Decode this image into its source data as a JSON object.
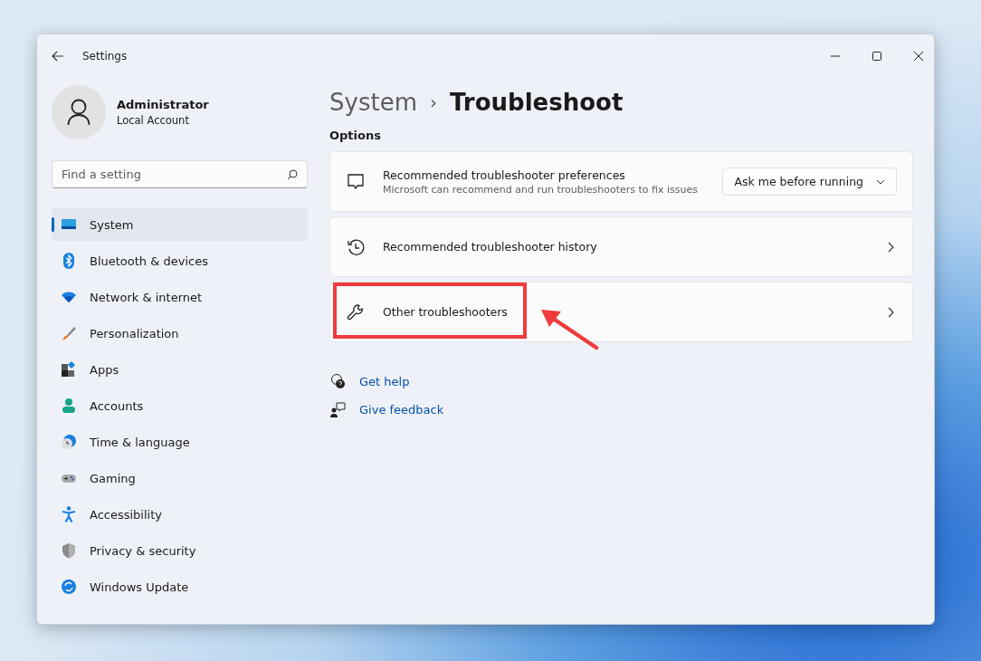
{
  "window": {
    "title": "Settings"
  },
  "account": {
    "name": "Administrator",
    "type": "Local Account"
  },
  "search": {
    "placeholder": "Find a setting"
  },
  "sidebar": {
    "items": [
      {
        "label": "System",
        "selected": true
      },
      {
        "label": "Bluetooth & devices",
        "selected": false
      },
      {
        "label": "Network & internet",
        "selected": false
      },
      {
        "label": "Personalization",
        "selected": false
      },
      {
        "label": "Apps",
        "selected": false
      },
      {
        "label": "Accounts",
        "selected": false
      },
      {
        "label": "Time & language",
        "selected": false
      },
      {
        "label": "Gaming",
        "selected": false
      },
      {
        "label": "Accessibility",
        "selected": false
      },
      {
        "label": "Privacy & security",
        "selected": false
      },
      {
        "label": "Windows Update",
        "selected": false
      }
    ]
  },
  "breadcrumb": {
    "parent": "System",
    "separator": "›",
    "current": "Troubleshoot"
  },
  "section": {
    "title": "Options"
  },
  "options": [
    {
      "kind": "dropdown",
      "title": "Recommended troubleshooter preferences",
      "subtitle": "Microsoft can recommend and run troubleshooters to fix issues",
      "value": "Ask me before running",
      "highlighted": false
    },
    {
      "kind": "link",
      "title": "Recommended troubleshooter history",
      "highlighted": false
    },
    {
      "kind": "link",
      "title": "Other troubleshooters",
      "highlighted": true
    }
  ],
  "help_links": [
    {
      "label": "Get help"
    },
    {
      "label": "Give feedback"
    }
  ]
}
